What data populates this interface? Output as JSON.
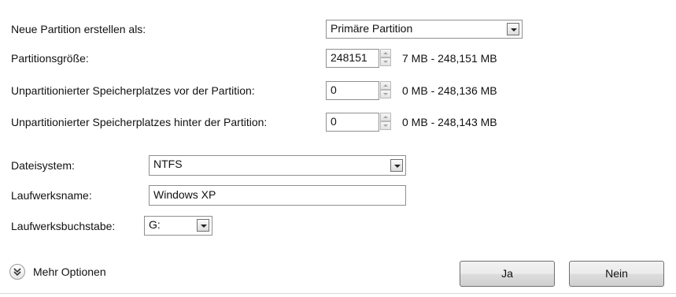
{
  "partition_type": {
    "label": "Neue Partition erstellen als:",
    "selected": "Primäre Partition"
  },
  "partition_size": {
    "label": "Partitionsgröße:",
    "value": "248151",
    "range": "7 MB - 248,151 MB"
  },
  "space_before": {
    "label": "Unpartitionierter Speicherplatzes vor der Partition:",
    "value": "0",
    "range": "0 MB - 248,136 MB"
  },
  "space_after": {
    "label": "Unpartitionierter Speicherplatzes hinter der Partition:",
    "value": "0",
    "range": "0 MB - 248,143 MB"
  },
  "file_system": {
    "label": "Dateisystem:",
    "selected": "NTFS"
  },
  "volume_name": {
    "label": "Laufwerksname:",
    "value": "Windows XP"
  },
  "drive_letter": {
    "label": "Laufwerksbuchstabe:",
    "selected": "G:"
  },
  "more_options": {
    "label": "Mehr Optionen",
    "icon": "double-chevron-down-icon"
  },
  "buttons": {
    "yes": "Ja",
    "no": "Nein"
  }
}
